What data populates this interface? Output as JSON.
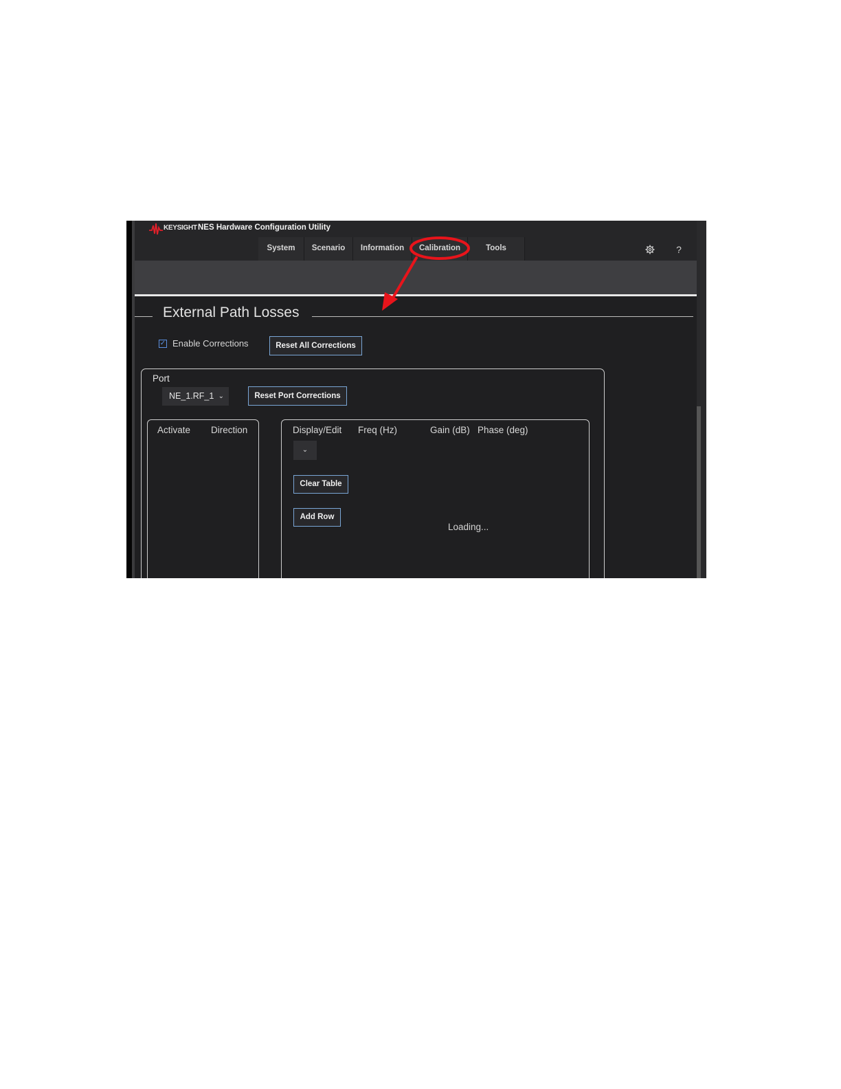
{
  "app": {
    "brand": "KEYSIGHT",
    "title": "NES Hardware Configuration Utility"
  },
  "nav": {
    "tabs": [
      {
        "label": "System"
      },
      {
        "label": "Scenario"
      },
      {
        "label": "Information"
      },
      {
        "label": "Calibration",
        "active": true
      },
      {
        "label": "Tools"
      }
    ],
    "settings_icon": "gear-icon",
    "help_label": "?"
  },
  "section": {
    "title": "External Path Losses"
  },
  "corrections": {
    "enable_label": "Enable Corrections",
    "enabled": true,
    "reset_all_label": "Reset All Corrections"
  },
  "port": {
    "label": "Port",
    "selected": "NE_1.RF_1",
    "reset_label": "Reset Port Corrections"
  },
  "left_table": {
    "headers": [
      "Activate",
      "Direction"
    ]
  },
  "right_table": {
    "headers": [
      "Display/Edit",
      "Freq (Hz)",
      "Gain (dB)",
      "Phase (deg)"
    ],
    "clear_label": "Clear Table",
    "add_row_label": "Add Row",
    "status": "Loading..."
  },
  "colors": {
    "background": "#1f1f21",
    "accent_border": "#7aa6d6",
    "annotation": "#e8141b",
    "logo": "#e0202a"
  }
}
